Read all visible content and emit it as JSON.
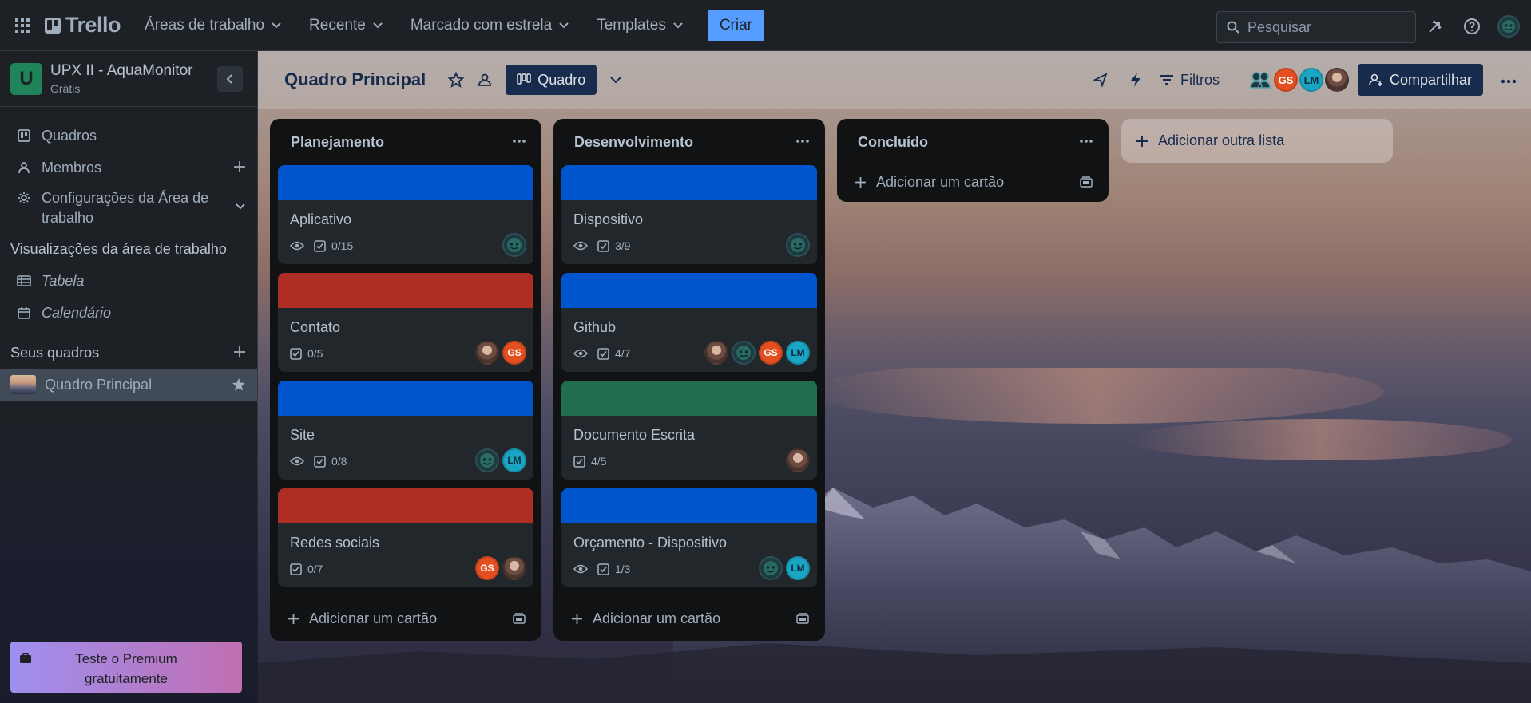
{
  "topbar": {
    "logo": "Trello",
    "nav": [
      {
        "label": "Áreas de trabalho"
      },
      {
        "label": "Recente"
      },
      {
        "label": "Marcado com estrela"
      },
      {
        "label": "Templates"
      }
    ],
    "create_label": "Criar",
    "search_placeholder": "Pesquisar"
  },
  "sidebar": {
    "workspace_initial": "U",
    "workspace_name": "UPX II - AquaMonitor",
    "workspace_plan": "Grátis",
    "items": [
      {
        "label": "Quadros"
      },
      {
        "label": "Membros"
      },
      {
        "label": "Configurações da Área de trabalho"
      }
    ],
    "views_title": "Visualizações da área de trabalho",
    "views": [
      {
        "label": "Tabela"
      },
      {
        "label": "Calendário"
      }
    ],
    "boards_title": "Seus quadros",
    "boards": [
      {
        "label": "Quadro Principal"
      }
    ],
    "premium_label": "Teste o Premium gratuitamente"
  },
  "board": {
    "title": "Quadro Principal",
    "view_label": "Quadro",
    "filters_label": "Filtros",
    "share_label": "Compartilhar",
    "members": [
      "GS",
      "LM"
    ],
    "add_list_label": "Adicionar outra lista",
    "add_card_label": "Adicionar um cartão",
    "lists": [
      {
        "title": "Planejamento",
        "cards": [
          {
            "title": "Aplicativo",
            "cover": "#0055cc",
            "watch": true,
            "checklist": "0/15",
            "members": [
              "bot"
            ]
          },
          {
            "title": "Contato",
            "cover": "#ae2e24",
            "watch": false,
            "checklist": "0/5",
            "members": [
              "face",
              "GS"
            ]
          },
          {
            "title": "Site",
            "cover": "#0055cc",
            "watch": true,
            "checklist": "0/8",
            "members": [
              "bot",
              "LM"
            ]
          },
          {
            "title": "Redes sociais",
            "cover": "#ae2e24",
            "watch": false,
            "checklist": "0/7",
            "members": [
              "GS",
              "face"
            ]
          }
        ]
      },
      {
        "title": "Desenvolvimento",
        "cards": [
          {
            "title": "Dispositivo",
            "cover": "#0055cc",
            "watch": true,
            "checklist": "3/9",
            "members": [
              "bot"
            ]
          },
          {
            "title": "Github",
            "cover": "#0055cc",
            "watch": true,
            "checklist": "4/7",
            "members": [
              "face",
              "bot",
              "GS",
              "LM"
            ]
          },
          {
            "title": "Documento Escrita",
            "cover": "#216e4e",
            "watch": false,
            "checklist": "4/5",
            "members": [
              "face"
            ]
          },
          {
            "title": "Orçamento - Dispositivo",
            "cover": "#0055cc",
            "watch": true,
            "checklist": "1/3",
            "members": [
              "bot",
              "LM"
            ]
          }
        ]
      },
      {
        "title": "Concluído",
        "cards": []
      }
    ]
  },
  "colors": {
    "accent": "#579dff",
    "board_header_text": "#172b4d",
    "workspace_avatar": "#1f845a",
    "member_gs": "#e34f20",
    "member_lm": "#1ba5c5"
  }
}
